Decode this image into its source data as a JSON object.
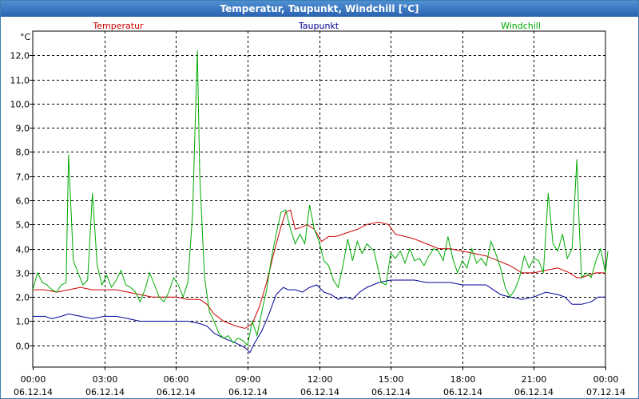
{
  "window": {
    "title": "Temperatur, Taupunkt, Windchill [°C]"
  },
  "chart_data": {
    "type": "line",
    "ylabel": "°C",
    "ylim": [
      -0.9,
      13.0
    ],
    "yticks": [
      0,
      1,
      2,
      3,
      4,
      5,
      6,
      7,
      8,
      9,
      10,
      11,
      12
    ],
    "ytick_labels": [
      "0,0",
      "1,0",
      "2,0",
      "3,0",
      "4,0",
      "5,0",
      "6,0",
      "7,0",
      "8,0",
      "9,0",
      "10,0",
      "11,0",
      "12,0"
    ],
    "xlim_hours": [
      0,
      24
    ],
    "xticks": [
      {
        "time": "00:00",
        "date": "06.12.14"
      },
      {
        "time": "03:00",
        "date": "06.12.14"
      },
      {
        "time": "06:00",
        "date": "06.12.14"
      },
      {
        "time": "09:00",
        "date": "06.12.14"
      },
      {
        "time": "12:00",
        "date": "06.12.14"
      },
      {
        "time": "15:00",
        "date": "06.12.14"
      },
      {
        "time": "18:00",
        "date": "06.12.14"
      },
      {
        "time": "21:00",
        "date": "06.12.14"
      },
      {
        "time": "00:00",
        "date": "07.12.14"
      }
    ],
    "grid": true,
    "legend_position": "top",
    "series": [
      {
        "name": "Temperatur",
        "color": "#cc0000",
        "points": [
          [
            0.0,
            2.3
          ],
          [
            0.5,
            2.3
          ],
          [
            1.0,
            2.2
          ],
          [
            1.5,
            2.3
          ],
          [
            2.0,
            2.4
          ],
          [
            2.5,
            2.3
          ],
          [
            3.0,
            2.3
          ],
          [
            3.5,
            2.3
          ],
          [
            4.0,
            2.2
          ],
          [
            4.5,
            2.1
          ],
          [
            5.0,
            2.0
          ],
          [
            5.5,
            2.0
          ],
          [
            6.0,
            2.0
          ],
          [
            6.5,
            1.9
          ],
          [
            7.0,
            1.9
          ],
          [
            7.3,
            1.7
          ],
          [
            7.6,
            1.3
          ],
          [
            8.0,
            1.0
          ],
          [
            8.5,
            0.8
          ],
          [
            8.9,
            0.7
          ],
          [
            9.2,
            0.9
          ],
          [
            9.5,
            1.6
          ],
          [
            9.8,
            2.6
          ],
          [
            10.1,
            3.8
          ],
          [
            10.4,
            4.9
          ],
          [
            10.6,
            5.5
          ],
          [
            10.8,
            5.6
          ],
          [
            11.0,
            4.8
          ],
          [
            11.3,
            4.9
          ],
          [
            11.5,
            5.0
          ],
          [
            11.8,
            4.8
          ],
          [
            12.1,
            4.3
          ],
          [
            12.4,
            4.5
          ],
          [
            12.7,
            4.5
          ],
          [
            13.0,
            4.6
          ],
          [
            13.3,
            4.7
          ],
          [
            13.6,
            4.8
          ],
          [
            14.0,
            5.0
          ],
          [
            14.5,
            5.1
          ],
          [
            14.9,
            5.0
          ],
          [
            15.2,
            4.6
          ],
          [
            15.6,
            4.5
          ],
          [
            16.0,
            4.4
          ],
          [
            16.5,
            4.2
          ],
          [
            17.0,
            4.0
          ],
          [
            17.5,
            4.0
          ],
          [
            18.0,
            3.9
          ],
          [
            18.5,
            3.8
          ],
          [
            19.0,
            3.7
          ],
          [
            19.5,
            3.5
          ],
          [
            20.0,
            3.3
          ],
          [
            20.5,
            3.0
          ],
          [
            21.0,
            3.0
          ],
          [
            21.5,
            3.1
          ],
          [
            22.0,
            3.2
          ],
          [
            22.5,
            3.0
          ],
          [
            22.8,
            2.8
          ],
          [
            23.0,
            2.8
          ],
          [
            23.3,
            2.9
          ],
          [
            23.6,
            3.0
          ],
          [
            24.0,
            3.0
          ]
        ]
      },
      {
        "name": "Taupunkt",
        "color": "#000099",
        "points": [
          [
            0.0,
            1.2
          ],
          [
            0.5,
            1.2
          ],
          [
            0.8,
            1.1
          ],
          [
            1.2,
            1.2
          ],
          [
            1.5,
            1.3
          ],
          [
            2.0,
            1.2
          ],
          [
            2.5,
            1.1
          ],
          [
            3.0,
            1.2
          ],
          [
            3.5,
            1.2
          ],
          [
            4.0,
            1.1
          ],
          [
            4.5,
            1.0
          ],
          [
            5.0,
            1.0
          ],
          [
            5.5,
            1.0
          ],
          [
            6.0,
            1.0
          ],
          [
            6.5,
            1.0
          ],
          [
            7.0,
            0.9
          ],
          [
            7.3,
            0.8
          ],
          [
            7.6,
            0.5
          ],
          [
            8.0,
            0.3
          ],
          [
            8.5,
            0.1
          ],
          [
            8.9,
            -0.1
          ],
          [
            9.1,
            -0.3
          ],
          [
            9.3,
            0.1
          ],
          [
            9.6,
            0.6
          ],
          [
            9.9,
            1.3
          ],
          [
            10.2,
            2.1
          ],
          [
            10.5,
            2.4
          ],
          [
            10.7,
            2.3
          ],
          [
            11.0,
            2.3
          ],
          [
            11.3,
            2.2
          ],
          [
            11.6,
            2.4
          ],
          [
            11.9,
            2.5
          ],
          [
            12.2,
            2.2
          ],
          [
            12.5,
            2.1
          ],
          [
            12.8,
            1.9
          ],
          [
            13.1,
            2.0
          ],
          [
            13.4,
            1.9
          ],
          [
            13.7,
            2.2
          ],
          [
            14.0,
            2.4
          ],
          [
            14.5,
            2.6
          ],
          [
            15.0,
            2.7
          ],
          [
            15.5,
            2.7
          ],
          [
            16.0,
            2.7
          ],
          [
            16.5,
            2.6
          ],
          [
            17.0,
            2.6
          ],
          [
            17.5,
            2.6
          ],
          [
            18.0,
            2.5
          ],
          [
            18.5,
            2.5
          ],
          [
            19.0,
            2.5
          ],
          [
            19.3,
            2.3
          ],
          [
            19.6,
            2.1
          ],
          [
            20.0,
            2.0
          ],
          [
            20.5,
            1.9
          ],
          [
            21.0,
            2.0
          ],
          [
            21.5,
            2.2
          ],
          [
            22.0,
            2.1
          ],
          [
            22.3,
            2.0
          ],
          [
            22.6,
            1.7
          ],
          [
            23.0,
            1.7
          ],
          [
            23.4,
            1.8
          ],
          [
            23.7,
            2.0
          ],
          [
            24.0,
            2.0
          ]
        ]
      },
      {
        "name": "Windchill",
        "color": "#00aa00",
        "points": [
          [
            0.0,
            2.3
          ],
          [
            0.2,
            3.0
          ],
          [
            0.4,
            2.6
          ],
          [
            0.6,
            2.5
          ],
          [
            0.8,
            2.3
          ],
          [
            1.0,
            2.2
          ],
          [
            1.2,
            2.5
          ],
          [
            1.4,
            2.6
          ],
          [
            1.5,
            7.9
          ],
          [
            1.7,
            3.5
          ],
          [
            1.9,
            3.0
          ],
          [
            2.1,
            2.5
          ],
          [
            2.3,
            2.7
          ],
          [
            2.5,
            6.3
          ],
          [
            2.7,
            3.3
          ],
          [
            2.9,
            2.5
          ],
          [
            3.1,
            2.9
          ],
          [
            3.3,
            2.4
          ],
          [
            3.5,
            2.7
          ],
          [
            3.7,
            3.1
          ],
          [
            3.9,
            2.5
          ],
          [
            4.1,
            2.4
          ],
          [
            4.3,
            2.2
          ],
          [
            4.5,
            1.8
          ],
          [
            4.7,
            2.3
          ],
          [
            4.9,
            3.0
          ],
          [
            5.1,
            2.5
          ],
          [
            5.3,
            2.0
          ],
          [
            5.5,
            1.8
          ],
          [
            5.7,
            2.2
          ],
          [
            5.9,
            2.8
          ],
          [
            6.1,
            2.5
          ],
          [
            6.3,
            2.0
          ],
          [
            6.5,
            2.6
          ],
          [
            6.7,
            5.5
          ],
          [
            6.8,
            9.0
          ],
          [
            6.9,
            12.2
          ],
          [
            7.0,
            7.0
          ],
          [
            7.2,
            2.8
          ],
          [
            7.4,
            1.4
          ],
          [
            7.6,
            1.0
          ],
          [
            7.8,
            0.5
          ],
          [
            8.0,
            0.3
          ],
          [
            8.2,
            0.4
          ],
          [
            8.4,
            0.1
          ],
          [
            8.6,
            0.3
          ],
          [
            8.8,
            0.2
          ],
          [
            9.0,
            0.0
          ],
          [
            9.2,
            1.0
          ],
          [
            9.4,
            0.4
          ],
          [
            9.6,
            1.4
          ],
          [
            9.8,
            2.3
          ],
          [
            10.0,
            3.6
          ],
          [
            10.2,
            4.6
          ],
          [
            10.4,
            5.5
          ],
          [
            10.6,
            5.6
          ],
          [
            10.8,
            4.8
          ],
          [
            11.0,
            4.2
          ],
          [
            11.2,
            4.6
          ],
          [
            11.4,
            4.2
          ],
          [
            11.6,
            5.8
          ],
          [
            11.8,
            4.8
          ],
          [
            12.0,
            4.3
          ],
          [
            12.2,
            3.5
          ],
          [
            12.4,
            3.3
          ],
          [
            12.6,
            2.7
          ],
          [
            12.8,
            2.4
          ],
          [
            13.0,
            3.3
          ],
          [
            13.2,
            4.4
          ],
          [
            13.4,
            3.5
          ],
          [
            13.6,
            4.3
          ],
          [
            13.8,
            3.8
          ],
          [
            14.0,
            4.2
          ],
          [
            14.3,
            3.9
          ],
          [
            14.6,
            2.6
          ],
          [
            14.8,
            2.5
          ],
          [
            15.0,
            3.8
          ],
          [
            15.2,
            3.6
          ],
          [
            15.4,
            3.9
          ],
          [
            15.6,
            3.4
          ],
          [
            15.8,
            4.0
          ],
          [
            16.0,
            3.5
          ],
          [
            16.2,
            3.6
          ],
          [
            16.4,
            3.3
          ],
          [
            16.6,
            3.7
          ],
          [
            16.8,
            4.0
          ],
          [
            17.0,
            3.9
          ],
          [
            17.2,
            3.5
          ],
          [
            17.4,
            4.5
          ],
          [
            17.6,
            3.6
          ],
          [
            17.8,
            3.0
          ],
          [
            18.0,
            3.5
          ],
          [
            18.2,
            3.2
          ],
          [
            18.4,
            4.0
          ],
          [
            18.6,
            3.4
          ],
          [
            18.8,
            3.6
          ],
          [
            19.0,
            3.3
          ],
          [
            19.2,
            4.3
          ],
          [
            19.4,
            3.8
          ],
          [
            19.6,
            3.2
          ],
          [
            19.8,
            2.4
          ],
          [
            20.0,
            2.0
          ],
          [
            20.2,
            2.3
          ],
          [
            20.4,
            2.8
          ],
          [
            20.6,
            3.7
          ],
          [
            20.8,
            3.2
          ],
          [
            21.0,
            3.6
          ],
          [
            21.2,
            3.5
          ],
          [
            21.4,
            3.0
          ],
          [
            21.6,
            6.3
          ],
          [
            21.8,
            4.2
          ],
          [
            22.0,
            3.9
          ],
          [
            22.2,
            4.6
          ],
          [
            22.4,
            3.6
          ],
          [
            22.6,
            4.0
          ],
          [
            22.8,
            7.7
          ],
          [
            22.9,
            5.0
          ],
          [
            23.0,
            2.8
          ],
          [
            23.2,
            3.0
          ],
          [
            23.4,
            2.8
          ],
          [
            23.6,
            3.5
          ],
          [
            23.8,
            4.0
          ],
          [
            24.0,
            3.0
          ],
          [
            24.1,
            3.9
          ]
        ]
      }
    ]
  }
}
